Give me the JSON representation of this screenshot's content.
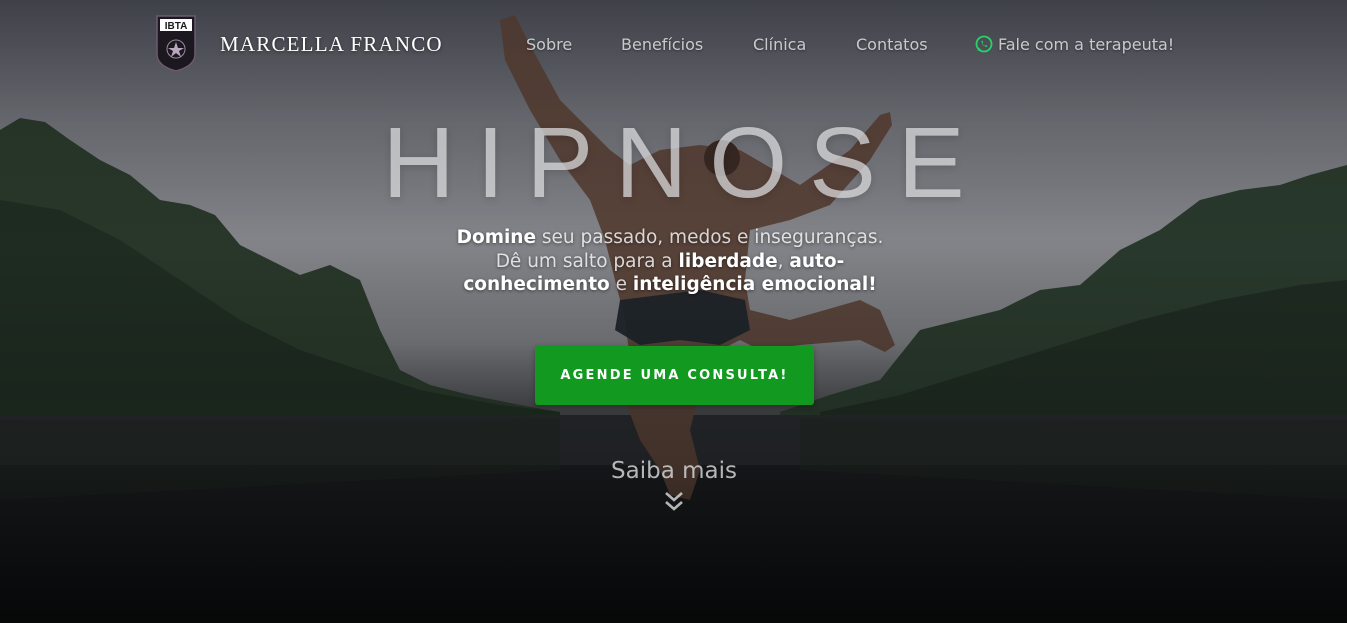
{
  "header": {
    "logo_text": "IBTA",
    "brand_name": "MARCELLA FRANCO",
    "nav": [
      {
        "label": "Sobre"
      },
      {
        "label": "Benefícios"
      },
      {
        "label": "Clínica"
      },
      {
        "label": "Contatos"
      },
      {
        "label": "Fale com a terapeuta!",
        "icon": "whatsapp-icon"
      }
    ]
  },
  "hero": {
    "title": "HIPNOSE",
    "tagline": {
      "l1_strong": "Domine",
      "l1_rest": " seu passado, medos e inseguranças.",
      "l2_pre": "Dê um salto para a ",
      "l2_strong1": "liberdade",
      "l2_mid": ", ",
      "l2_strong2": "auto-",
      "l3_strong1": "conhecimento",
      "l3_mid": " e ",
      "l3_strong2": "inteligência emocional!"
    },
    "cta_label": "AGENDE UMA CONSULTA!",
    "more_label": "Saiba mais",
    "more_icon": "double-chevron-down-icon"
  },
  "colors": {
    "cta": "#119a1f",
    "whatsapp": "#25d366"
  }
}
